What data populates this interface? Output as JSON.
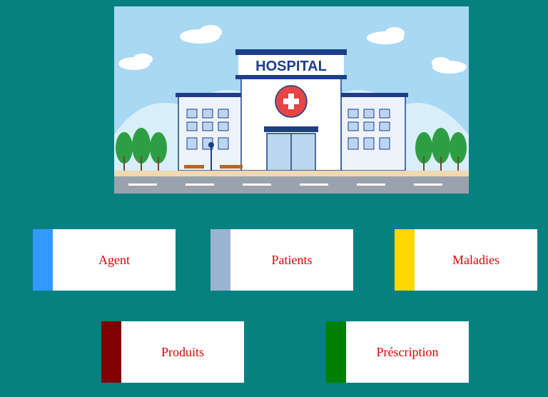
{
  "banner": {
    "sign_text": "HOSPITAL",
    "alt": "hospital illustration"
  },
  "menu": [
    {
      "label": "Agent",
      "color": "#3399ff"
    },
    {
      "label": "Patients",
      "color": "#99b4d1"
    },
    {
      "label": "Maladies",
      "color": "#ffd700"
    },
    {
      "label": "Produits",
      "color": "#800000"
    },
    {
      "label": "Préscription",
      "color": "#008000"
    }
  ]
}
